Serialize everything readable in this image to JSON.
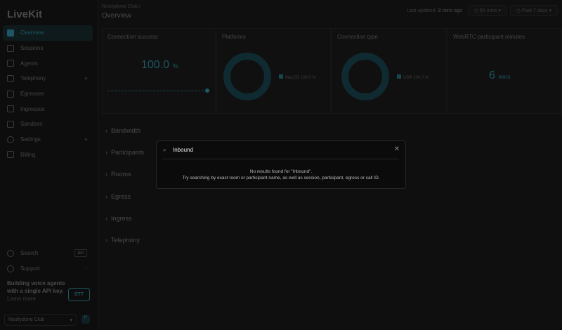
{
  "sidebar": {
    "logo": "LiveKit",
    "items": [
      {
        "label": "Overview",
        "active": true
      },
      {
        "label": "Sessions"
      },
      {
        "label": "Agents"
      },
      {
        "label": "Telephony",
        "chevron": true
      },
      {
        "label": "Egresses"
      },
      {
        "label": "Ingresses"
      },
      {
        "label": "Sandbox"
      },
      {
        "label": "Settings",
        "chevron": true
      },
      {
        "label": "Billing"
      }
    ],
    "search_label": "Search",
    "search_shortcut": "⌘K",
    "support_label": "Support",
    "promo": {
      "text": "Building voice agents with a single API key.",
      "link": "Learn more",
      "badge": "STT"
    },
    "project": "Nicelydone Club",
    "project_initial": "P"
  },
  "header": {
    "breadcrumb": "Nicelydone Club /",
    "title": "Overview",
    "last_updated_prefix": "Last updated",
    "last_updated": "8 mins ago",
    "interval": "60 mins",
    "range": "Past 7 days"
  },
  "cards": {
    "connection_success": {
      "title": "Connection success",
      "value": "100.0",
      "unit": "%"
    },
    "platforms": {
      "title": "Platforms",
      "legend": "MacOS",
      "pct": "100.0 %"
    },
    "connection_type": {
      "title": "Connection type",
      "legend": "UDP",
      "pct": "100.0 %"
    },
    "webrtc": {
      "title": "WebRTC participant minutes",
      "value": "6",
      "unit": "mins"
    }
  },
  "sections": [
    "Bandwidth",
    "Participants",
    "Rooms",
    "Egress",
    "Ingress",
    "Telephony"
  ],
  "modal": {
    "query": "Inbound",
    "no_results": "No results found for \"Inbound\".",
    "hint": "Try searching by exact room or participant name, as well as session, participant, egress or call ID."
  },
  "colors": {
    "accent": "#3fb6d0"
  }
}
